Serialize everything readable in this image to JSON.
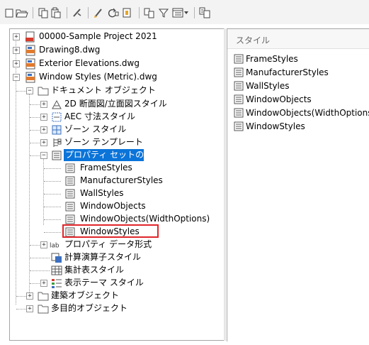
{
  "toolbar": {
    "icons": [
      "new-page-icon",
      "open-folder-icon",
      "copy-icon",
      "paste-icon",
      "purge-icon",
      "brush-icon",
      "refresh-icon",
      "import-icon",
      "export-icon",
      "filter-icon",
      "view-options-icon",
      "dropdown-icon",
      "compare-icon"
    ]
  },
  "tree": {
    "drawings": [
      {
        "label": "00000-Sample Project 2021"
      },
      {
        "label": "Drawing8.dwg"
      },
      {
        "label": "Exterior Elevations.dwg"
      },
      {
        "label": "Window Styles (Metric).dwg"
      }
    ],
    "doc_objects": "ドキュメント オブジェクト",
    "doc_children": [
      {
        "label": "2D 断面図/立面図スタイル"
      },
      {
        "label": "AEC 寸法スタイル"
      },
      {
        "label": "ゾーン スタイル"
      },
      {
        "label": "ゾーン テンプレート"
      },
      {
        "label": "プロパティ セットの定義"
      }
    ],
    "psd_children": [
      {
        "label": "FrameStyles"
      },
      {
        "label": "ManufacturerStyles"
      },
      {
        "label": "WallStyles"
      },
      {
        "label": "WindowObjects"
      },
      {
        "label": "WindowObjects(WidthOptions)"
      },
      {
        "label": "WindowStyles"
      }
    ],
    "doc_after": [
      {
        "label": "プロパティ データ形式"
      },
      {
        "label": "計算演算子スタイル"
      },
      {
        "label": "集計表スタイル"
      },
      {
        "label": "表示テーマ スタイル"
      }
    ],
    "root_after": [
      {
        "label": "建築オブジェクト"
      },
      {
        "label": "多目的オブジェクト"
      }
    ]
  },
  "list": {
    "header": "スタイル",
    "items": [
      "FrameStyles",
      "ManufacturerStyles",
      "WallStyles",
      "WindowObjects",
      "WindowObjects(WidthOptions)",
      "WindowStyles"
    ]
  },
  "colors": {
    "selection": "#0b74d9",
    "highlight_box": "#e0262b"
  }
}
